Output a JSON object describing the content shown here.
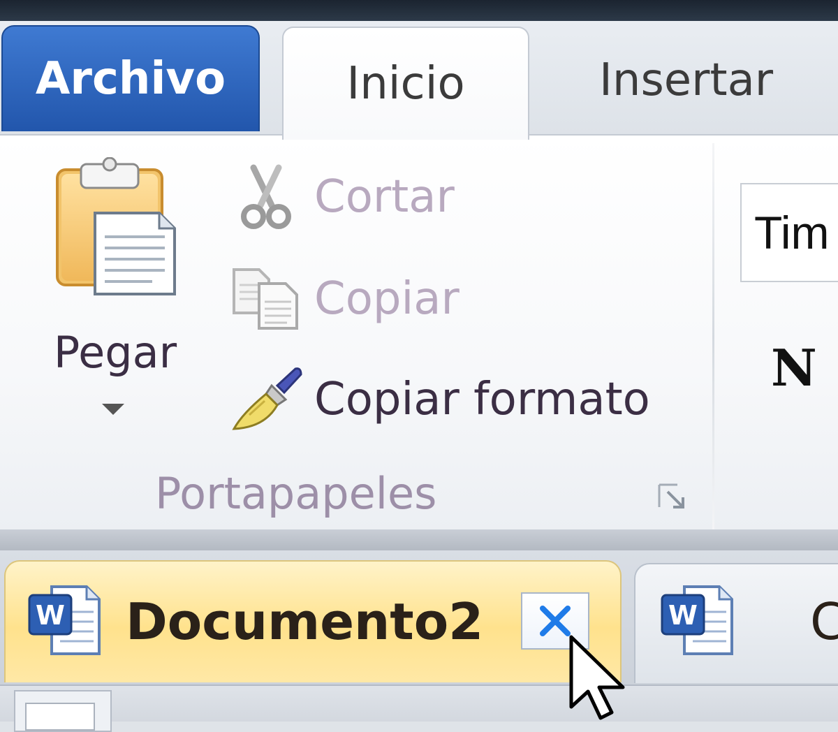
{
  "ribbon_tabs": {
    "file": "Archivo",
    "home": "Inicio",
    "insert": "Insertar"
  },
  "clipboard": {
    "paste": "Pegar",
    "cut": "Cortar",
    "copy": "Copiar",
    "format_painter": "Copiar formato",
    "group_label": "Portapapeles"
  },
  "font": {
    "font_name_partial": "Tim",
    "bold_glyph": "N"
  },
  "documents": {
    "active_tab": "Documento2",
    "second_tab_partial": "C"
  },
  "colors": {
    "file_tab": "#2a5fb8",
    "active_doc_tab": "#ffe28d",
    "close_x": "#1f7be8"
  }
}
